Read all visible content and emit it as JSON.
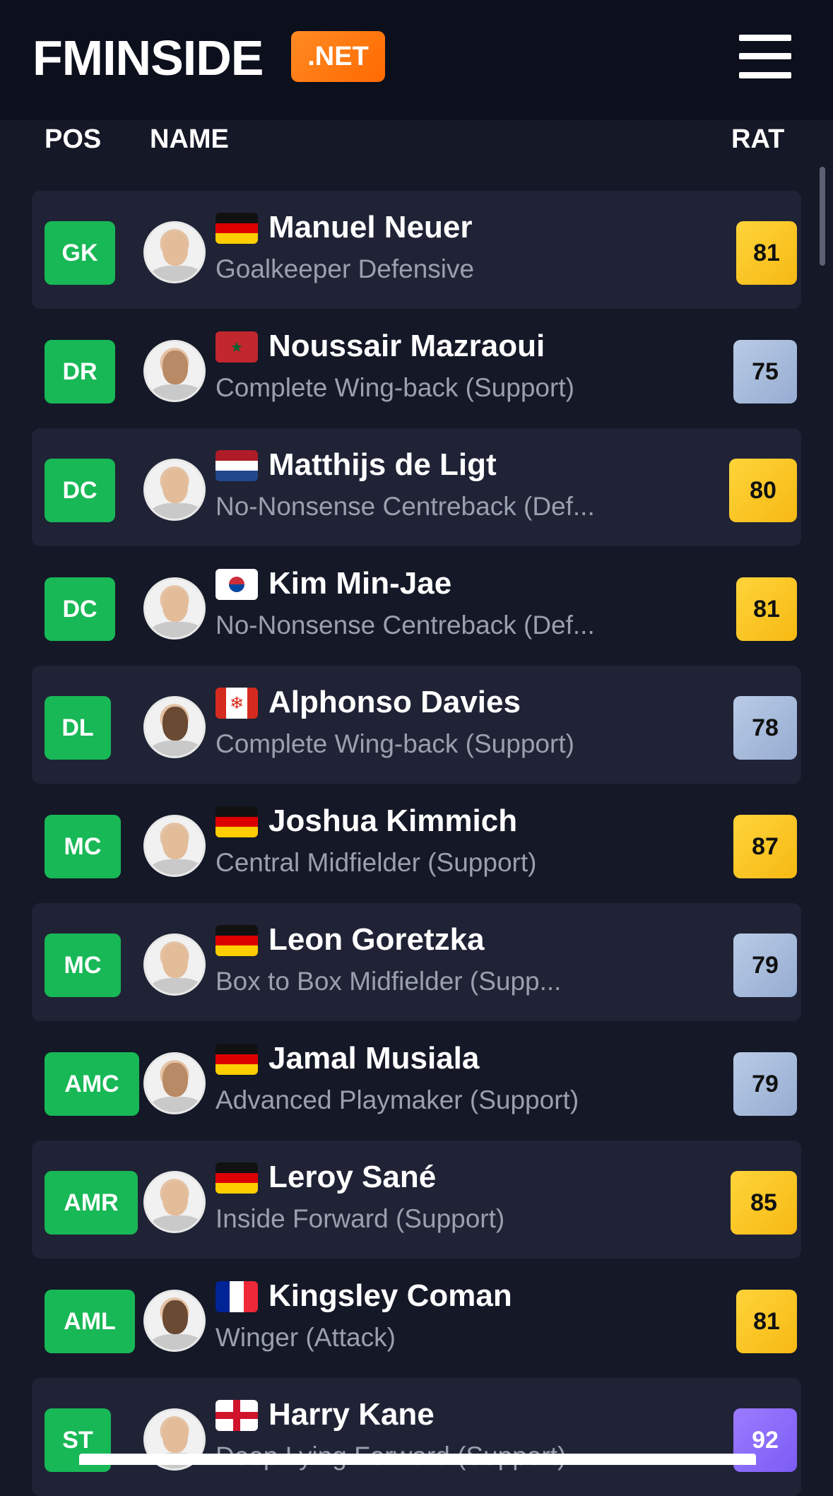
{
  "header": {
    "logo_text": "FMINSIDE",
    "logo_badge": ".NET",
    "menu_icon": "hamburger-icon"
  },
  "columns": {
    "pos": "POS",
    "name": "NAME",
    "rat": "RAT"
  },
  "colors": {
    "pos_badge": "#18b856",
    "rating_gold": "#f6b913",
    "rating_silver": "#96acd1",
    "rating_purple": "#7c5cf5",
    "accent": "#ff6a00"
  },
  "players": [
    {
      "pos": "GK",
      "name": "Manuel Neuer",
      "role": "Goalkeeper Defensive",
      "rating": "81",
      "tier": "gold",
      "flag": "germany"
    },
    {
      "pos": "DR",
      "name": "Noussair Mazraoui",
      "role": "Complete Wing-back (Support)",
      "rating": "75",
      "tier": "silver",
      "flag": "morocco"
    },
    {
      "pos": "DC",
      "name": "Matthijs de Ligt",
      "role": "No-Nonsense Centreback (Def...",
      "rating": "80",
      "tier": "gold",
      "flag": "netherlands"
    },
    {
      "pos": "DC",
      "name": "Kim Min-Jae",
      "role": "No-Nonsense Centreback (Def...",
      "rating": "81",
      "tier": "gold",
      "flag": "south-korea"
    },
    {
      "pos": "DL",
      "name": "Alphonso Davies",
      "role": "Complete Wing-back (Support)",
      "rating": "78",
      "tier": "silver",
      "flag": "canada"
    },
    {
      "pos": "MC",
      "name": "Joshua Kimmich",
      "role": "Central Midfielder (Support)",
      "rating": "87",
      "tier": "gold",
      "flag": "germany"
    },
    {
      "pos": "MC",
      "name": "Leon Goretzka",
      "role": "Box to Box Midfielder (Supp...",
      "rating": "79",
      "tier": "silver",
      "flag": "germany"
    },
    {
      "pos": "AMC",
      "name": "Jamal Musiala",
      "role": "Advanced Playmaker (Support)",
      "rating": "79",
      "tier": "silver",
      "flag": "germany"
    },
    {
      "pos": "AMR",
      "name": "Leroy Sané",
      "role": "Inside Forward (Support)",
      "rating": "85",
      "tier": "gold",
      "flag": "germany"
    },
    {
      "pos": "AML",
      "name": "Kingsley Coman",
      "role": "Winger (Attack)",
      "rating": "81",
      "tier": "gold",
      "flag": "france"
    },
    {
      "pos": "ST",
      "name": "Harry Kane",
      "role": "Deep Lying Forward (Support)",
      "rating": "92",
      "tier": "purple",
      "flag": "england"
    }
  ]
}
